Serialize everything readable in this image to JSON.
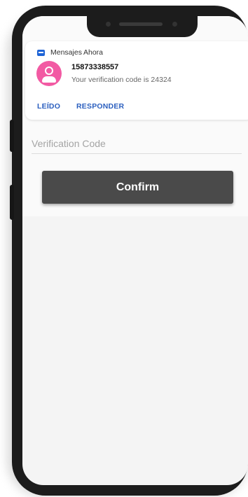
{
  "notification": {
    "app_name": "Mensajes",
    "time": "Ahora",
    "sender": "15873338557",
    "message": "Your verification code is 24324",
    "actions": {
      "read": "LEÍDO",
      "reply": "RESPONDER"
    },
    "app_icon": "messages-icon",
    "avatar_icon": "person-icon"
  },
  "form": {
    "code_placeholder": "Verification Code",
    "code_value": "",
    "confirm_label": "Confirm"
  },
  "colors": {
    "avatar": "#f25aa3",
    "action_text": "#2b5fbf",
    "confirm_button": "#4a4a4a"
  }
}
